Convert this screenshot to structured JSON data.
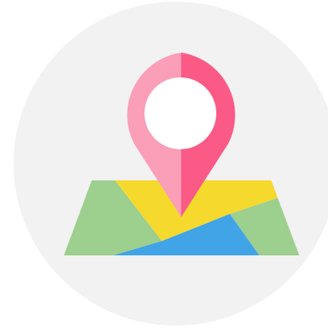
{
  "icon": {
    "name": "map-location-pin-icon",
    "colors": {
      "page_background": "#ffffff",
      "circle_background": "#f2f2f2",
      "map_green": "#9dcf8e",
      "map_yellow": "#f6d92d",
      "map_blue": "#40a4e6",
      "pin_light": "#fb9eb8",
      "pin_dark": "#fb5a86",
      "pin_hole": "#ffffff"
    }
  }
}
